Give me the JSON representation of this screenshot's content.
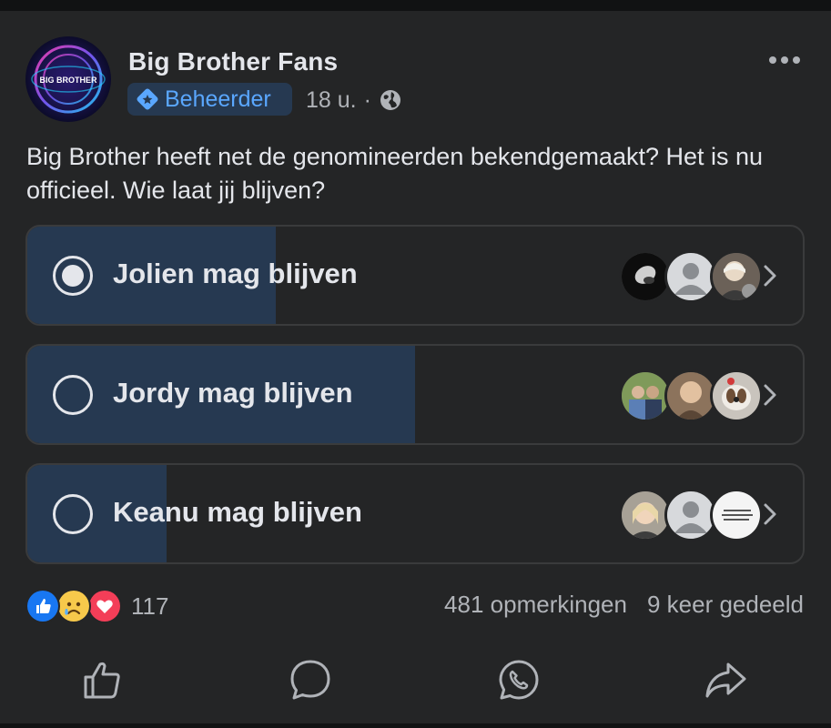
{
  "post": {
    "group_name": "Big Brother Fans",
    "role_badge": "Beheerder",
    "time": "18 u.",
    "separator": "·",
    "audience_icon": "globe-icon",
    "text": "Big Brother heeft net de genomineerden bekendgemaakt? Het is nu officieel. Wie laat jij blijven?",
    "avatar_logo_text": "BIG BROTHER"
  },
  "poll": {
    "options": [
      {
        "label": "Jolien mag blijven",
        "selected": true,
        "vote_fraction": 0.32
      },
      {
        "label": "Jordy mag blijven",
        "selected": false,
        "vote_fraction": 0.5
      },
      {
        "label": "Keanu mag blijven",
        "selected": false,
        "vote_fraction": 0.18
      }
    ]
  },
  "footer": {
    "reaction_icons": [
      "like-icon",
      "sad-icon",
      "love-icon"
    ],
    "reaction_count": "117",
    "comments": "481 opmerkingen",
    "shares": "9 keer gedeeld"
  },
  "actions": [
    "like-icon",
    "comment-icon",
    "whatsapp-icon",
    "share-icon"
  ],
  "colors": {
    "background": "#242526",
    "poll_fill": "#263951",
    "accent": "#5aa7ff",
    "text": "#e4e6eb",
    "muted": "#b0b3b8"
  }
}
